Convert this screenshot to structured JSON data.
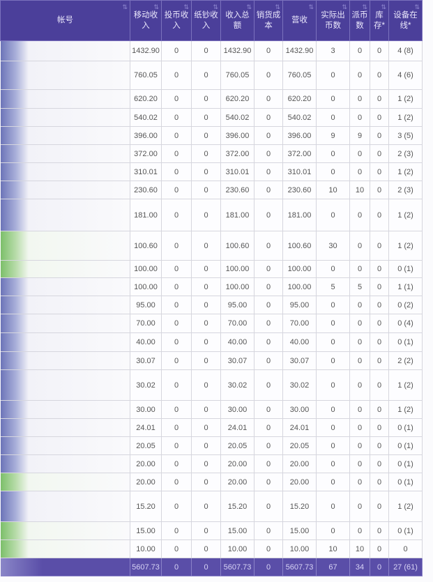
{
  "header": {
    "columns": [
      "帐号",
      "移动收入",
      "投币收入",
      "纸钞收入",
      "收入总额",
      "销货成本",
      "营收",
      "实际出币数",
      "派币数",
      "库存*",
      "设备在线*"
    ],
    "sort_icon": "sort-arrows-icon"
  },
  "rows": [
    [
      "1432.90",
      "0",
      "0",
      "1432.90",
      "0",
      "1432.90",
      "3",
      "0",
      "0",
      "4 (8)"
    ],
    [
      "760.05",
      "0",
      "0",
      "760.05",
      "0",
      "760.05",
      "0",
      "0",
      "0",
      "4 (6)"
    ],
    [
      "620.20",
      "0",
      "0",
      "620.20",
      "0",
      "620.20",
      "0",
      "0",
      "0",
      "1 (2)"
    ],
    [
      "540.02",
      "0",
      "0",
      "540.02",
      "0",
      "540.02",
      "0",
      "0",
      "0",
      "1 (2)"
    ],
    [
      "396.00",
      "0",
      "0",
      "396.00",
      "0",
      "396.00",
      "9",
      "9",
      "0",
      "3 (5)"
    ],
    [
      "372.00",
      "0",
      "0",
      "372.00",
      "0",
      "372.00",
      "0",
      "0",
      "0",
      "2 (3)"
    ],
    [
      "310.01",
      "0",
      "0",
      "310.01",
      "0",
      "310.01",
      "0",
      "0",
      "0",
      "1 (2)"
    ],
    [
      "230.60",
      "0",
      "0",
      "230.60",
      "0",
      "230.60",
      "10",
      "10",
      "0",
      "2 (3)"
    ],
    [
      "181.00",
      "0",
      "0",
      "181.00",
      "0",
      "181.00",
      "0",
      "0",
      "0",
      "1 (2)"
    ],
    [
      "100.60",
      "0",
      "0",
      "100.60",
      "0",
      "100.60",
      "30",
      "0",
      "0",
      "1 (2)"
    ],
    [
      "100.00",
      "0",
      "0",
      "100.00",
      "0",
      "100.00",
      "0",
      "0",
      "0",
      "0 (1)"
    ],
    [
      "100.00",
      "0",
      "0",
      "100.00",
      "0",
      "100.00",
      "5",
      "5",
      "0",
      "1 (1)"
    ],
    [
      "95.00",
      "0",
      "0",
      "95.00",
      "0",
      "95.00",
      "0",
      "0",
      "0",
      "0 (2)"
    ],
    [
      "70.00",
      "0",
      "0",
      "70.00",
      "0",
      "70.00",
      "0",
      "0",
      "0",
      "0 (4)"
    ],
    [
      "40.00",
      "0",
      "0",
      "40.00",
      "0",
      "40.00",
      "0",
      "0",
      "0",
      "0 (1)"
    ],
    [
      "30.07",
      "0",
      "0",
      "30.07",
      "0",
      "30.07",
      "0",
      "0",
      "0",
      "2 (2)"
    ],
    [
      "30.02",
      "0",
      "0",
      "30.02",
      "0",
      "30.02",
      "0",
      "0",
      "0",
      "1 (2)"
    ],
    [
      "30.00",
      "0",
      "0",
      "30.00",
      "0",
      "30.00",
      "0",
      "0",
      "0",
      "1 (2)"
    ],
    [
      "24.01",
      "0",
      "0",
      "24.01",
      "0",
      "24.01",
      "0",
      "0",
      "0",
      "0 (1)"
    ],
    [
      "20.05",
      "0",
      "0",
      "20.05",
      "0",
      "20.05",
      "0",
      "0",
      "0",
      "0 (1)"
    ],
    [
      "20.00",
      "0",
      "0",
      "20.00",
      "0",
      "20.00",
      "0",
      "0",
      "0",
      "0 (1)"
    ],
    [
      "20.00",
      "0",
      "0",
      "20.00",
      "0",
      "20.00",
      "0",
      "0",
      "0",
      "0 (1)"
    ],
    [
      "15.20",
      "0",
      "0",
      "15.20",
      "0",
      "15.20",
      "0",
      "0",
      "0",
      "1 (2)"
    ],
    [
      "15.00",
      "0",
      "0",
      "15.00",
      "0",
      "15.00",
      "0",
      "0",
      "0",
      "0 (1)"
    ],
    [
      "10.00",
      "0",
      "0",
      "10.00",
      "0",
      "10.00",
      "10",
      "10",
      "0",
      "0"
    ]
  ],
  "total": [
    "5607.73",
    "0",
    "0",
    "5607.73",
    "0",
    "5607.73",
    "67",
    "34",
    "0",
    "27 (61)"
  ],
  "colors": {
    "header": "#4b3f9a",
    "total": "#5a4ea8"
  }
}
